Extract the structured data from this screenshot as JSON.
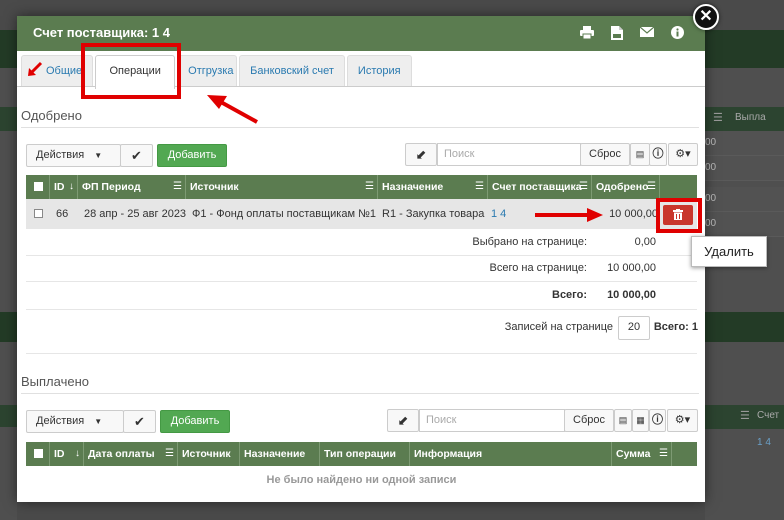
{
  "modal": {
    "title": "Счет поставщика: 1 4"
  },
  "tabs": [
    {
      "label": "Общие"
    },
    {
      "label": "Операции"
    },
    {
      "label": "Отгрузка"
    },
    {
      "label": "Банковский счет"
    },
    {
      "label": "История"
    }
  ],
  "approved": {
    "section_title": "Одобрено",
    "actions_label": "Действия",
    "add_label": "Добавить",
    "search_placeholder": "Поиск",
    "reset_label": "Сброс",
    "columns": [
      "ID",
      "ФП Период",
      "Источник",
      "Назначение",
      "Счет поставщика",
      "Одобрено"
    ],
    "rows": [
      {
        "id": "66",
        "period": "28 апр - 25 авг 2023",
        "source": "Ф1 - Фонд оплаты поставщикам №1",
        "destination": "R1 - Закупка товара",
        "invoice": "1 4",
        "approved": "10 000,00"
      }
    ],
    "summary": {
      "selected_label": "Выбрано на странице:",
      "selected_value": "0,00",
      "page_total_label": "Всего на странице:",
      "page_total_value": "10 000,00",
      "total_label": "Всего:",
      "total_value": "10 000,00",
      "per_page_label": "Записей на странице",
      "per_page_value": "20",
      "count_label": "Всего: 1"
    },
    "tooltip": "Удалить"
  },
  "paid": {
    "section_title": "Выплачено",
    "actions_label": "Действия",
    "add_label": "Добавить",
    "search_placeholder": "Поиск",
    "reset_label": "Сброс",
    "columns": [
      "ID",
      "Дата оплаты",
      "Источник",
      "Назначение",
      "Тип операции",
      "Информация",
      "Сумма"
    ],
    "empty_message": "Не было найдено ни одной записи"
  },
  "background": {
    "right_header_1": "Выпла",
    "right_rows": [
      "00",
      "00",
      "00",
      "00"
    ],
    "right_header_2": "Счет",
    "right_link": "1 4"
  },
  "colors": {
    "header_green": "#5b7c50",
    "add_green": "#52a852",
    "link_blue": "#2a7ab0",
    "delete_red": "#c9362c",
    "annotation_red": "#e00000"
  }
}
